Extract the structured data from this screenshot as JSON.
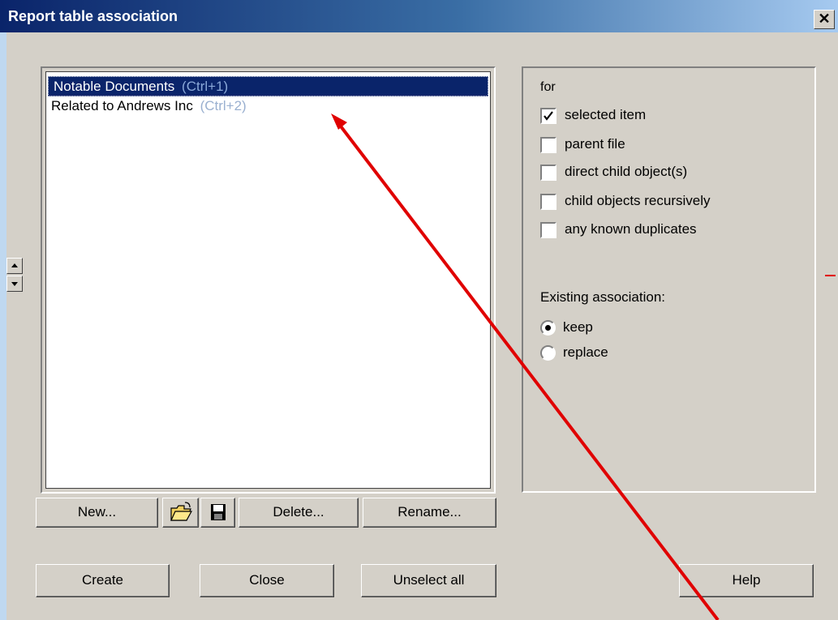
{
  "window": {
    "title": "Report table association"
  },
  "list": {
    "items": [
      {
        "label": "Notable Documents",
        "shortcut": "(Ctrl+1)",
        "selected": true
      },
      {
        "label": "Related to Andrews Inc",
        "shortcut": "(Ctrl+2)",
        "selected": false
      }
    ]
  },
  "list_buttons": {
    "new": "New...",
    "open_icon": "folder-open-icon",
    "save_icon": "floppy-disk-icon",
    "delete": "Delete...",
    "rename": "Rename..."
  },
  "options": {
    "for_label": "for",
    "checkboxes": [
      {
        "label": "selected item",
        "checked": true
      },
      {
        "label": "parent file",
        "checked": false
      },
      {
        "label": "direct child object(s)",
        "checked": false
      },
      {
        "label": "child objects recursively",
        "checked": false
      },
      {
        "label": "any known duplicates",
        "checked": false
      }
    ],
    "existing_label": "Existing association:",
    "radios": [
      {
        "label": "keep",
        "selected": true
      },
      {
        "label": "replace",
        "selected": false
      }
    ]
  },
  "buttons": {
    "create": "Create",
    "close": "Close",
    "unselect_all": "Unselect all",
    "help": "Help"
  },
  "colors": {
    "selection": "#0a246a",
    "dialog_bg": "#d4d0c8",
    "annotation_arrow": "#e00000"
  }
}
